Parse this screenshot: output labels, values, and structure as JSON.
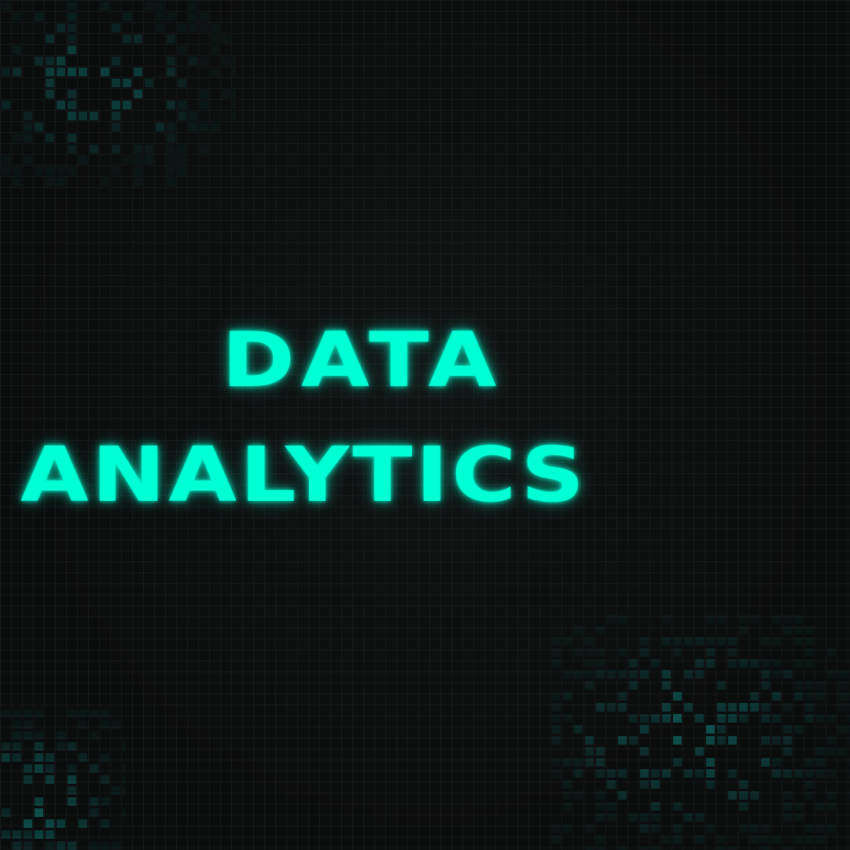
{
  "title": {
    "line1": "DATA",
    "line2": "ANALYTICS"
  },
  "colors": {
    "background": "#0b0c0c",
    "accent": "#00ffd5",
    "pixel": "#0f7b74"
  }
}
